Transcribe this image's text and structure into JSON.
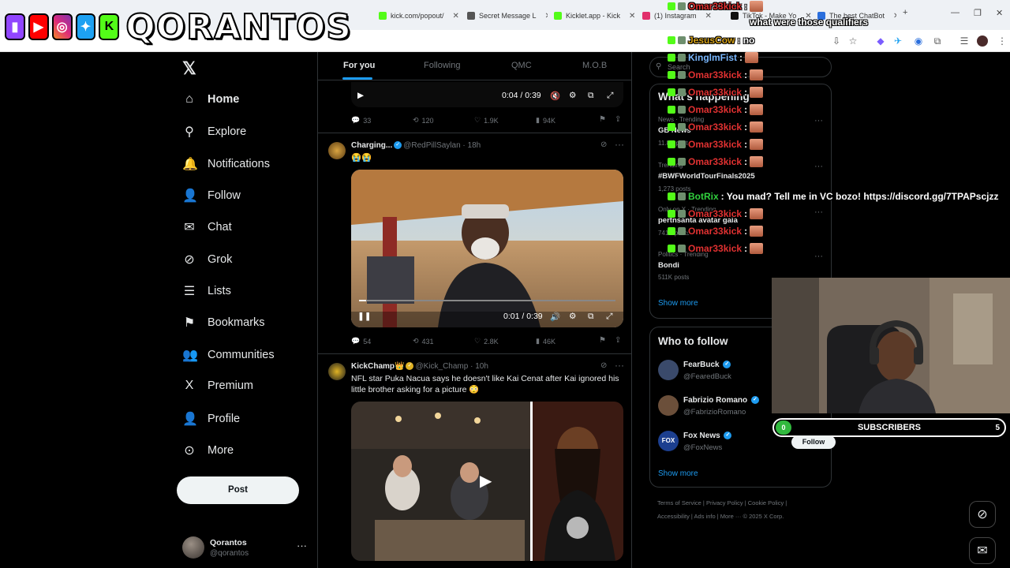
{
  "browser": {
    "tabs": [
      {
        "label": "kick.com/popout/",
        "color": "#53fc18"
      },
      {
        "label": "Secret Message L",
        "color": "#555555"
      },
      {
        "label": "Kicklet.app - Kick",
        "color": "#53fc18"
      },
      {
        "label": "(1) Instagram",
        "color": "#e1306c"
      },
      {
        "label": "TikTok - Make Yo",
        "color": "#000000"
      },
      {
        "label": "The best ChatBot",
        "color": "#2b6fdd"
      }
    ],
    "new_tab": "+"
  },
  "overlay": {
    "brand_name": "QORANTOS",
    "chat": [
      {
        "user": "Omar33kick",
        "color": "#e03131",
        "msg": ":",
        "emote": true
      },
      {
        "user": "",
        "color": "#e03131",
        "msg": "what were those qualifiers",
        "emote": false
      },
      {
        "user": "JesusCow",
        "color": "#d4a017",
        "msg": ": no",
        "emote": false
      },
      {
        "user": "KinglmFist",
        "color": "#7ab8ff",
        "msg": ":",
        "emote": true
      },
      {
        "user": "Omar33kick",
        "color": "#e03131",
        "msg": ":",
        "emote": true
      },
      {
        "user": "Omar33kick",
        "color": "#e03131",
        "msg": ":",
        "emote": true
      },
      {
        "user": "Omar33kick",
        "color": "#e03131",
        "msg": ":",
        "emote": true
      },
      {
        "user": "Omar33kick",
        "color": "#e03131",
        "msg": ":",
        "emote": true
      },
      {
        "user": "Omar33kick",
        "color": "#e03131",
        "msg": ":",
        "emote": true
      },
      {
        "user": "Omar33kick",
        "color": "#e03131",
        "msg": ":",
        "emote": true
      },
      {
        "user": "BotRix",
        "color": "#31d13e",
        "msg": ": You mad? Tell me in VC bozo! https://discord.gg/7TPAPscjzz",
        "emote": false
      },
      {
        "user": "Omar33kick",
        "color": "#e03131",
        "msg": ":",
        "emote": true
      },
      {
        "user": "Omar33kick",
        "color": "#e03131",
        "msg": ":",
        "emote": true
      },
      {
        "user": "Omar33kick",
        "color": "#e03131",
        "msg": ":",
        "emote": true
      }
    ],
    "subscribers": {
      "label": "SUBSCRIBERS",
      "current": "0",
      "goal": "5"
    }
  },
  "nav": {
    "items": [
      {
        "label": "Home",
        "icon": "home-icon",
        "glyph": "⌂"
      },
      {
        "label": "Explore",
        "icon": "search-icon",
        "glyph": "⚲"
      },
      {
        "label": "Notifications",
        "icon": "bell-icon",
        "glyph": "🔔"
      },
      {
        "label": "Follow",
        "icon": "add-person-icon",
        "glyph": "👤"
      },
      {
        "label": "Chat",
        "icon": "mail-icon",
        "glyph": "✉"
      },
      {
        "label": "Grok",
        "icon": "grok-icon",
        "glyph": "⊘"
      },
      {
        "label": "Lists",
        "icon": "lists-icon",
        "glyph": "☰"
      },
      {
        "label": "Bookmarks",
        "icon": "bookmark-icon",
        "glyph": "⚑"
      },
      {
        "label": "Communities",
        "icon": "communities-icon",
        "glyph": "👥"
      },
      {
        "label": "Premium",
        "icon": "x-premium-icon",
        "glyph": "X"
      },
      {
        "label": "Profile",
        "icon": "profile-icon",
        "glyph": "👤"
      },
      {
        "label": "More",
        "icon": "more-circle-icon",
        "glyph": "⊙"
      }
    ],
    "post_label": "Post",
    "profile": {
      "name": "Qorantos",
      "handle": "@qorantos"
    }
  },
  "feed": {
    "tabs": [
      "For you",
      "Following",
      "QMC",
      "M.O.B"
    ],
    "tweet0": {
      "video_time": "0:04 / 0:39",
      "replies": "33",
      "reposts": "120",
      "likes": "1.9K",
      "views": "94K"
    },
    "tweet1": {
      "author": "Charging...",
      "handle": "@RedPillSaylan · 18h",
      "text": "😭😭",
      "video_time": "0:01 / 0:39",
      "replies": "54",
      "reposts": "431",
      "likes": "2.8K",
      "views": "46K"
    },
    "tweet2": {
      "author": "KickChamp👑",
      "handle": "@Kick_Champ · 10h",
      "text": "NFL star Puka Nacua says he doesn't like Kai Cenat after Kai ignored his little brother asking for a picture 😳"
    }
  },
  "right": {
    "search_placeholder": "Search",
    "happening_title": "What's happening",
    "trends": [
      {
        "meta": "News · Trending",
        "name": "GB News",
        "count": "11.8K posts"
      },
      {
        "meta": "Trending",
        "name": "#BWFWorldTourFinals2025",
        "count": "1,273 posts"
      },
      {
        "meta": "Only on X · Trending",
        "name": "pertnsanta avatar gaia",
        "count": "741K posts"
      },
      {
        "meta": "Politics · Trending",
        "name": "Bondi",
        "count": "511K posts"
      }
    ],
    "show_more": "Show more",
    "wtf_title": "Who to follow",
    "wtf": [
      {
        "name": "FearBuck",
        "handle": "@FearedBuck",
        "color": "#3a4a6b"
      },
      {
        "name": "Fabrizio Romano",
        "handle": "@FabrizioRomano",
        "color": "#6b4f3a"
      },
      {
        "name": "Fox News",
        "handle": "@FoxNews",
        "color": "#1c3f8f"
      }
    ],
    "follow_label": "Follow",
    "footer1": "Terms of Service  |  Privacy Policy  |  Cookie Policy  |",
    "footer2": "Accessibility  |  Ads info  |  More ···  © 2025 X Corp."
  }
}
